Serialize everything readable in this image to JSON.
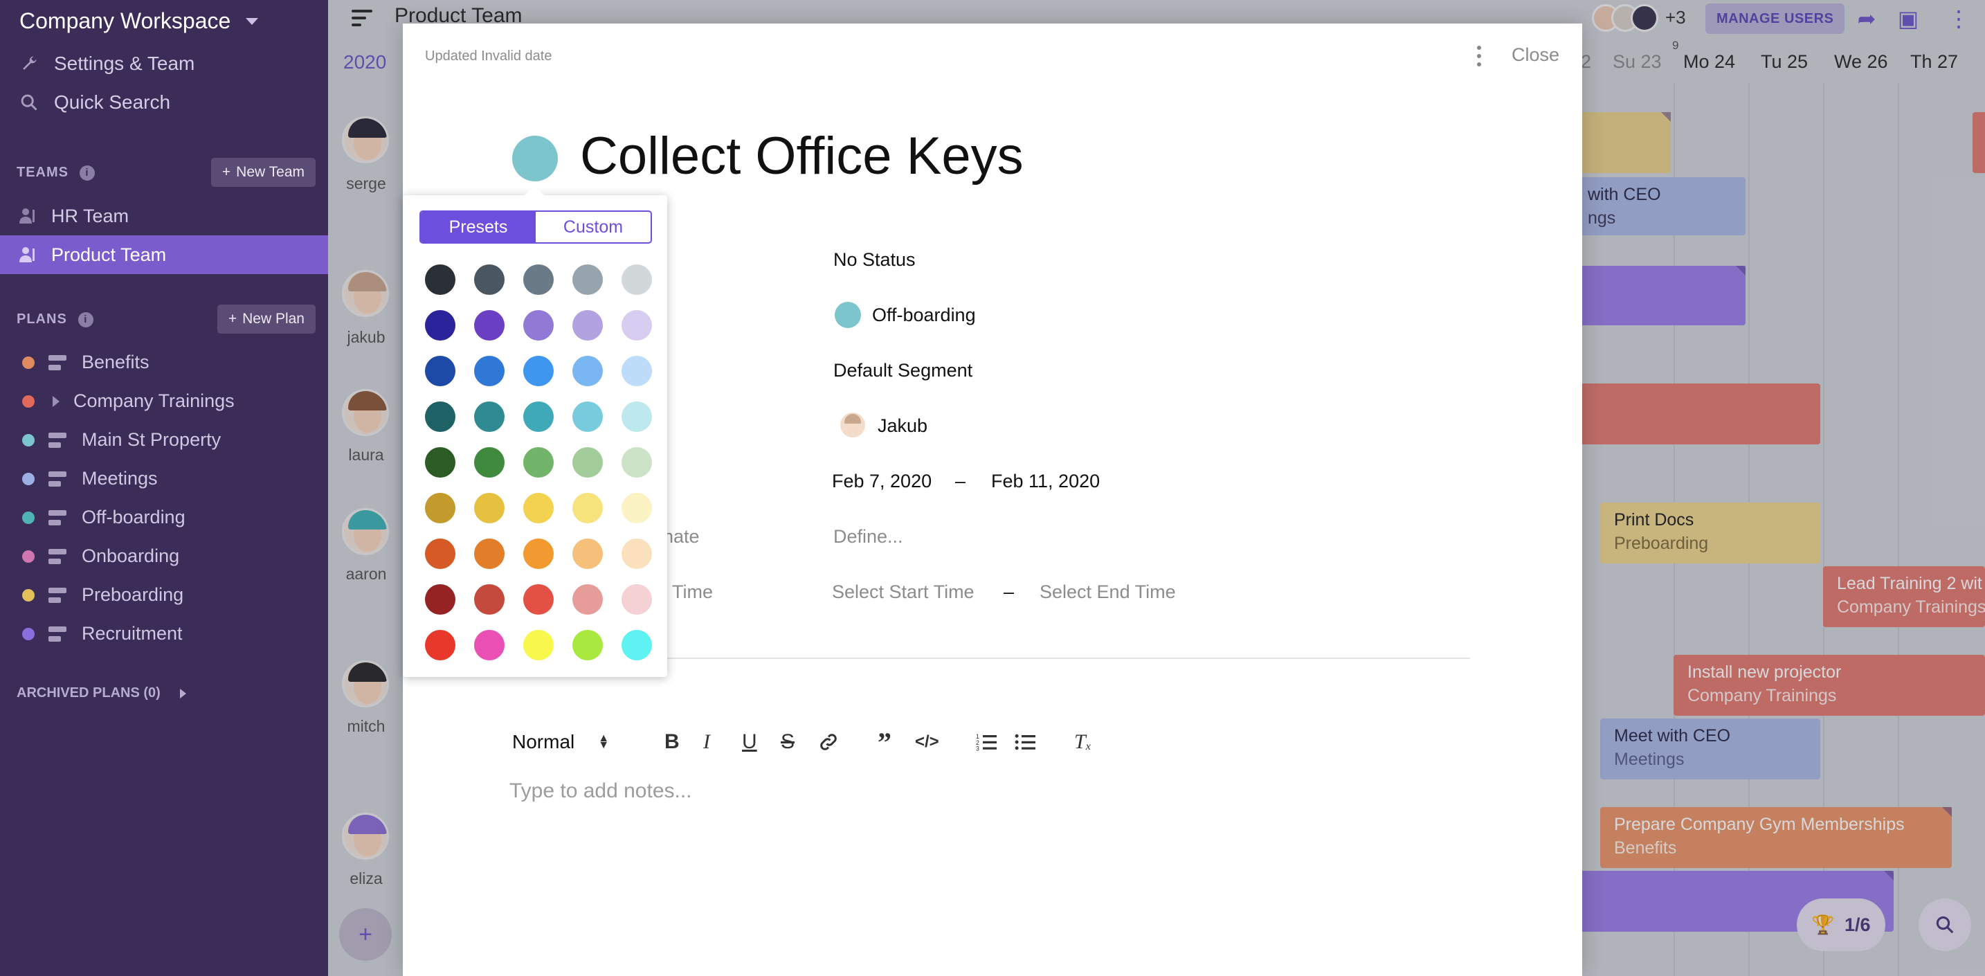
{
  "sidebar": {
    "workspace": "Company Workspace",
    "settings": "Settings & Team",
    "quick_search": "Quick Search",
    "teams_heading": "TEAMS",
    "new_team": "New Team",
    "teams": [
      {
        "label": "HR Team"
      },
      {
        "label": "Product Team"
      }
    ],
    "plans_heading": "PLANS",
    "new_plan": "New Plan",
    "plans": [
      {
        "label": "Benefits",
        "color": "#e08a5f"
      },
      {
        "label": "Company Trainings",
        "color": "#e06a5b"
      },
      {
        "label": "Main St Property",
        "color": "#7cc5cc"
      },
      {
        "label": "Meetings",
        "color": "#9db0e6"
      },
      {
        "label": "Off-boarding",
        "color": "#4fb3b3"
      },
      {
        "label": "Onboarding",
        "color": "#d177b0"
      },
      {
        "label": "Preboarding",
        "color": "#e3c15a"
      },
      {
        "label": "Recruitment",
        "color": "#8a6ee0"
      }
    ],
    "archived": "ARCHIVED PLANS (0)"
  },
  "calendar": {
    "board_title": "Product Team",
    "year": "2020",
    "people": [
      "serge",
      "jakub",
      "laura",
      "aaron",
      "mitch",
      "eliza"
    ],
    "extra_users": "+3",
    "manage_users": "MANAGE USERS",
    "days": [
      "2",
      "Su 23",
      "Mo 24",
      "Tu 25",
      "We 26",
      "Th 27"
    ],
    "day_marker": "9",
    "events": [
      {
        "title": "with CEO",
        "sub": "ngs"
      },
      {
        "title": "Print Docs",
        "sub": "Preboarding"
      },
      {
        "title": "Lead Training 2 wit",
        "sub": "Company Trainings"
      },
      {
        "title": "Install new projector",
        "sub": "Company Trainings"
      },
      {
        "title": "Meet with CEO",
        "sub": "Meetings"
      },
      {
        "title": "Prepare Company Gym Memberships",
        "sub": "Benefits"
      }
    ],
    "progress": "1/6"
  },
  "modal": {
    "updated": "Updated Invalid date",
    "close": "Close",
    "title": "Collect Office Keys",
    "task_color": "#7cc5cc",
    "status": "No Status",
    "plan": "Off-boarding",
    "segment": "Default Segment",
    "assignee": "Jakub",
    "start_date": "Feb 7, 2020",
    "end_date": "Feb 11, 2020",
    "date_sep": "–",
    "estimate_label": "nate",
    "estimate_value": "Define...",
    "time_label": "l Time",
    "start_time": "Select Start Time",
    "end_time": "Select End Time",
    "time_sep": "–",
    "text_style": "Normal",
    "notes_placeholder": "Type to add notes..."
  },
  "color_picker": {
    "tabs": [
      "Presets",
      "Custom"
    ],
    "active_tab": "Presets",
    "swatches": [
      [
        "#2b2f36",
        "#4a5660",
        "#6a7b87",
        "#96a4ad",
        "#d2d7da"
      ],
      [
        "#2a239a",
        "#6a3fc4",
        "#9279d6",
        "#b2a3e0",
        "#d7cdf0"
      ],
      [
        "#1c4aa6",
        "#2f78d6",
        "#3f96ee",
        "#7ab7f2",
        "#bcdcfa"
      ],
      [
        "#1e6266",
        "#2f8a92",
        "#3fa9b8",
        "#78cbdc",
        "#bde9ee"
      ],
      [
        "#2a5c24",
        "#3f8a3c",
        "#72b46a",
        "#a2cc9a",
        "#cde3c7"
      ],
      [
        "#c39a2c",
        "#e6c13f",
        "#f2d24f",
        "#f6e37c",
        "#fbf3c4"
      ],
      [
        "#d55a26",
        "#e27d2a",
        "#f29a2f",
        "#f6c07a",
        "#fae0bd"
      ],
      [
        "#962323",
        "#c44a3e",
        "#e35144",
        "#e69d9a",
        "#f6d1d3"
      ],
      [
        "#e8382c",
        "#ea4fb3",
        "#f7f74c",
        "#a8e83f",
        "#5ff2f2"
      ]
    ]
  }
}
